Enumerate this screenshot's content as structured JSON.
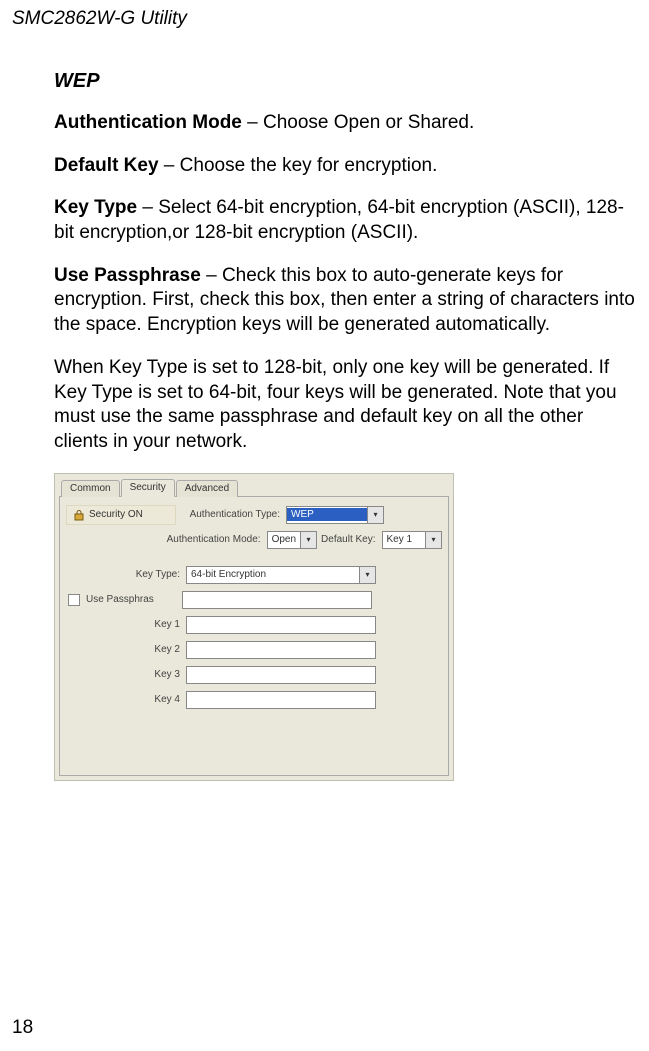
{
  "running_header": "SMC2862W-G Utility",
  "section_title": "WEP",
  "paragraphs": {
    "auth_mode_term": "Authentication Mode",
    "auth_mode_rest": " – Choose Open or Shared.",
    "default_key_term": "Default Key",
    "default_key_rest": " – Choose the key for encryption.",
    "key_type_term": "Key Type",
    "key_type_rest": " – Select 64-bit encryption, 64-bit encryption (ASCII), 128-bit encryption,or 128-bit encryption (ASCII).",
    "use_pass_term": "Use Passphrase",
    "use_pass_rest": " – Check this box to auto-generate keys for encryption. First, check this box, then enter a string of characters into the space. Encryption keys will be generated automatically.",
    "note": "When Key Type is set to 128-bit, only one key will be generated. If Key Type is set to 64-bit, four keys will be generated. Note that you must use the same passphrase and default key on all the other clients in your network."
  },
  "figure": {
    "tabs": {
      "common": "Common",
      "security": "Security",
      "advanced": "Advanced"
    },
    "security_on_label": "Security ON",
    "auth_type_label": "Authentication Type:",
    "auth_type_value": "WEP",
    "auth_mode_label": "Authentication Mode:",
    "auth_mode_value": "Open",
    "default_key_label": "Default Key:",
    "default_key_value": "Key 1",
    "key_type_label": "Key Type:",
    "key_type_value": "64-bit Encryption",
    "use_passphrase_label": "Use Passphras",
    "key1_label": "Key 1",
    "key2_label": "Key 2",
    "key3_label": "Key 3",
    "key4_label": "Key 4"
  },
  "page_number": "18"
}
